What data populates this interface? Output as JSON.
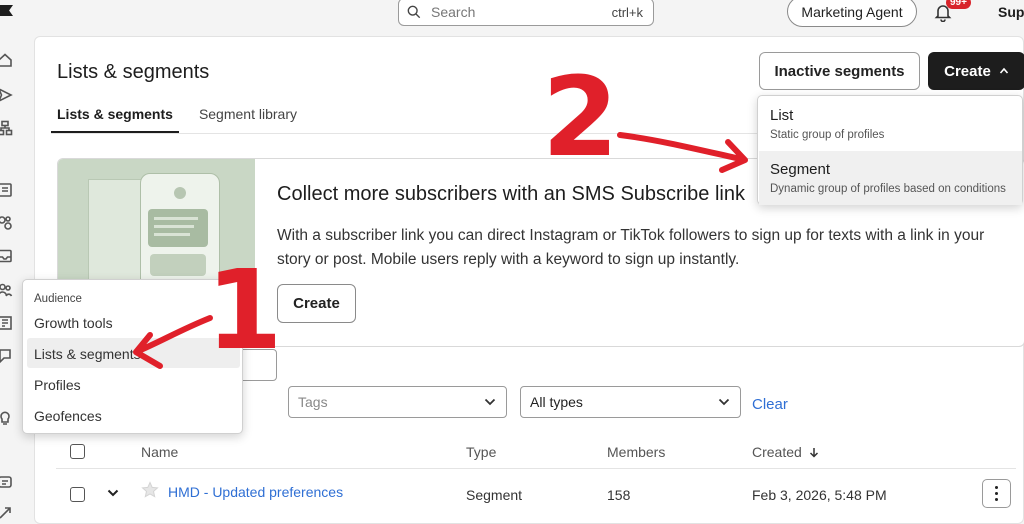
{
  "topbar": {
    "search_placeholder": "Search",
    "search_shortcut": "ctrl+k",
    "agent_button": "Marketing Agent",
    "notification_count": "99+",
    "user_label": "Supp"
  },
  "page": {
    "title": "Lists & segments",
    "tabs": [
      {
        "label": "Lists & segments",
        "active": true
      },
      {
        "label": "Segment library",
        "active": false
      }
    ],
    "inactive_button": "Inactive segments",
    "create_button": "Create"
  },
  "create_menu": {
    "items": [
      {
        "label": "List",
        "description": "Static group of profiles"
      },
      {
        "label": "Segment",
        "description": "Dynamic group of profiles based on conditions"
      }
    ]
  },
  "promo": {
    "title": "Collect more subscribers with an SMS Subscribe link",
    "body": "With a subscriber link you can direct Instagram or TikTok followers to sign up for texts with a link in your story or post. Mobile users reply with a keyword to sign up instantly.",
    "button": "Create"
  },
  "filters": {
    "tags_placeholder": "Tags",
    "types_value": "All types",
    "clear_label": "Clear"
  },
  "table": {
    "columns": {
      "name": "Name",
      "type": "Type",
      "members": "Members",
      "created": "Created"
    },
    "rows": [
      {
        "name": "HMD - Updated preferences",
        "type": "Segment",
        "members": "158",
        "created": "Feb 3, 2026, 5:48 PM"
      }
    ]
  },
  "audience_menu": {
    "heading": "Audience",
    "items": [
      "Growth tools",
      "Lists & segments",
      "Profiles",
      "Geofences"
    ],
    "selected": "Lists & segments"
  },
  "annotations": {
    "step_one": "1",
    "step_two": "2",
    "color": "#e0202a"
  },
  "colors": {
    "accent_link": "#2f6fd4",
    "primary_button": "#1d1d1d",
    "notification_badge": "#d8232a"
  }
}
